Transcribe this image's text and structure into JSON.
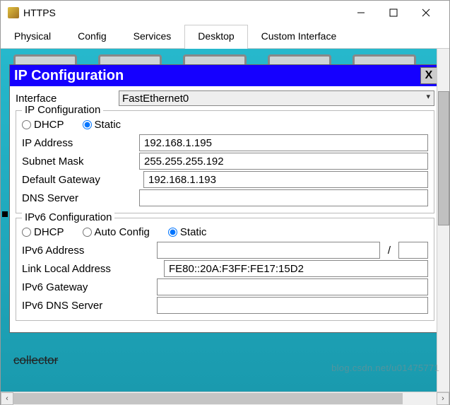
{
  "window": {
    "title": "HTTPS"
  },
  "tabs": [
    "Physical",
    "Config",
    "Services",
    "Desktop",
    "Custom Interface"
  ],
  "active_tab": "Desktop",
  "ipwin": {
    "title": "IP Configuration",
    "close": "X",
    "interface_label": "Interface",
    "interface_value": "FastEthernet0",
    "ipcfg": {
      "legend": "IP Configuration",
      "dhcp": "DHCP",
      "static": "Static",
      "mode": "Static",
      "ip_label": "IP Address",
      "ip_value": "192.168.1.195",
      "mask_label": "Subnet Mask",
      "mask_value": "255.255.255.192",
      "gw_label": "Default Gateway",
      "gw_value": "192.168.1.193",
      "dns_label": "DNS Server",
      "dns_value": ""
    },
    "ipv6": {
      "legend": "IPv6 Configuration",
      "dhcp": "DHCP",
      "auto": "Auto Config",
      "static": "Static",
      "mode": "Static",
      "addr_label": "IPv6 Address",
      "addr_value": "",
      "prefix_value": "",
      "lla_label": "Link Local Address",
      "lla_value": "FE80::20A:F3FF:FE17:15D2",
      "gw_label": "IPv6 Gateway",
      "gw_value": "",
      "dns_label": "IPv6 DNS Server",
      "dns_value": ""
    }
  },
  "watermark": "blog.csdn.net/u01475771",
  "bg_text": "collector"
}
